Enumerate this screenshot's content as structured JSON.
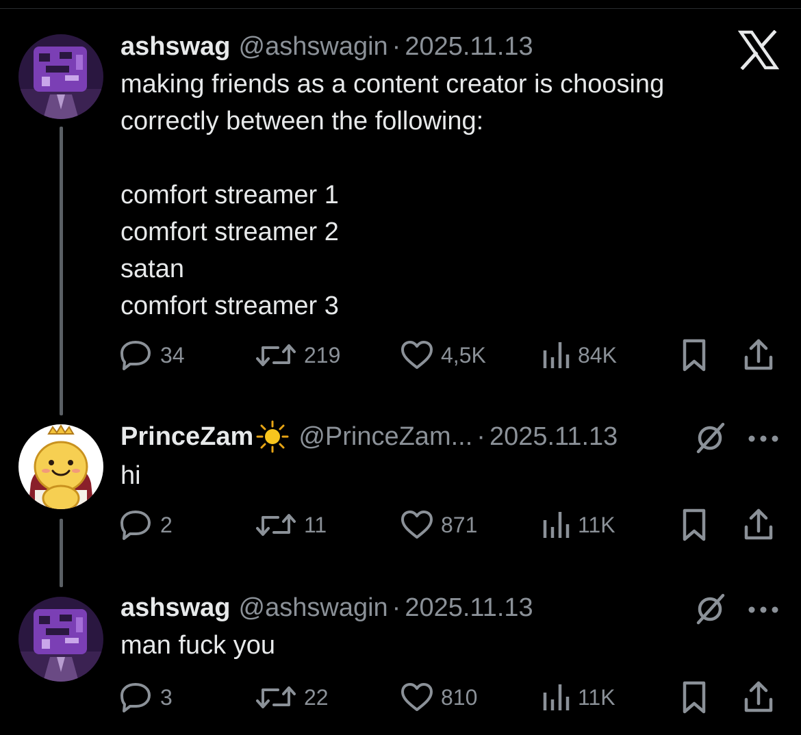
{
  "posts": [
    {
      "author": "ashswag",
      "handle": "@ashswagin",
      "separator": "·",
      "date": "2025.11.13",
      "text": "making friends as a content creator is choosing\ncorrectly between the following:\n\ncomfort streamer 1\ncomfort streamer 2\nsatan\ncomfort streamer 3",
      "replies": "34",
      "reposts": "219",
      "likes": "4,5K",
      "views": "84K",
      "avatar_icon": "purple-masked-character-avatar"
    },
    {
      "author": "PrinceZam",
      "handle": "@PrinceZam...",
      "separator": "·",
      "date": "2025.11.13",
      "badge_icon": "sun-emoji-icon",
      "text": "hi",
      "replies": "2",
      "reposts": "11",
      "likes": "871",
      "views": "11K",
      "avatar_icon": "yellow-cartoon-prince-avatar"
    },
    {
      "author": "ashswag",
      "handle": "@ashswagin",
      "separator": "·",
      "date": "2025.11.13",
      "text": "man fuck you",
      "replies": "3",
      "reposts": "22",
      "likes": "810",
      "views": "11K",
      "avatar_icon": "purple-masked-character-avatar"
    }
  ],
  "icons": {
    "brand": "x-logo-icon",
    "grok": "grok-icon",
    "more": "more-dots-icon",
    "reply": "reply-icon",
    "repost": "repost-icon",
    "like": "like-icon",
    "views": "views-icon",
    "bookmark": "bookmark-icon",
    "share": "share-icon"
  },
  "colors": {
    "background": "#000000",
    "text": "#e7e9ea",
    "secondary": "#8b9198",
    "thread_line": "#5a5f64",
    "avatar_purple": "#5b2d86"
  }
}
